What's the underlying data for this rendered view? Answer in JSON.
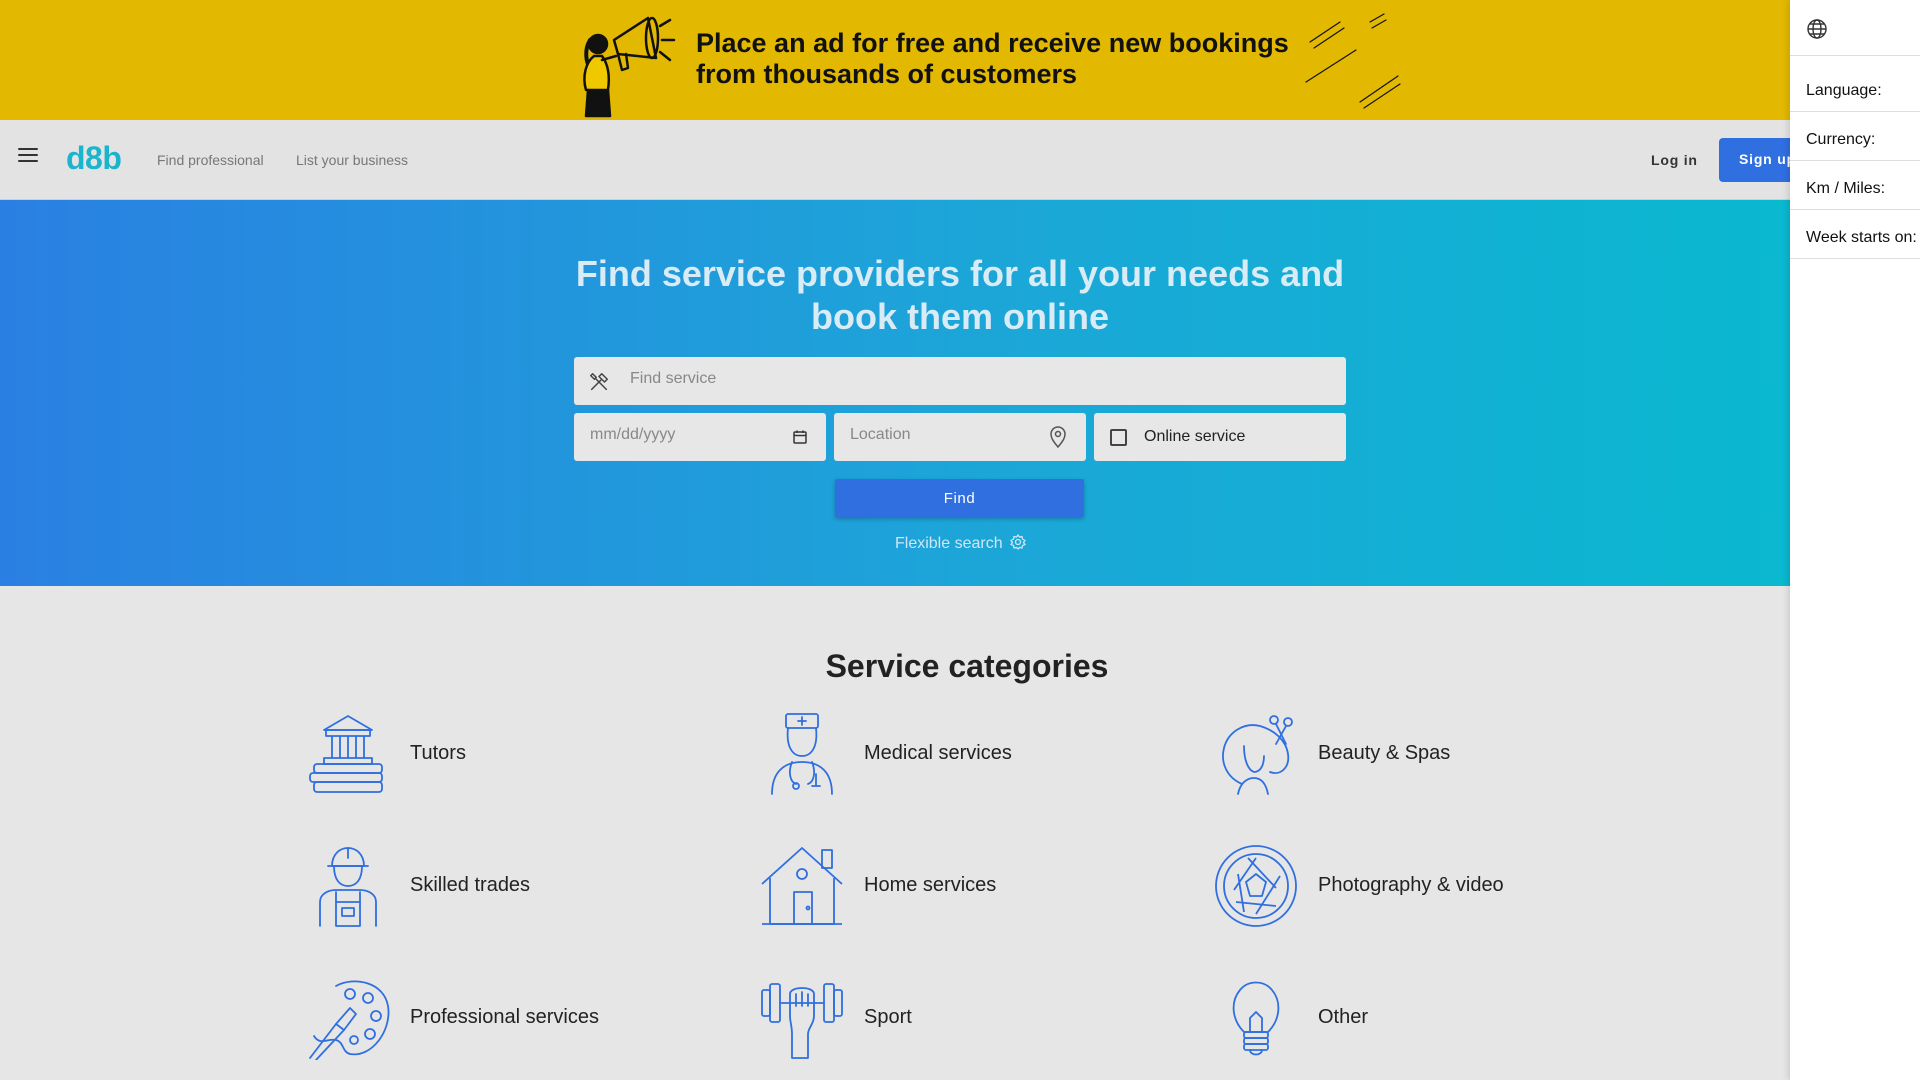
{
  "banner": {
    "text": "Place an ad for free and receive new bookings from thousands of customers"
  },
  "nav": {
    "logo": "d8b",
    "find_professional": "Find professional",
    "list_business": "List your business",
    "login": "Log in",
    "signup": "Sign up"
  },
  "hero": {
    "title": "Find service providers for all your needs and book them online",
    "service_placeholder": "Find service",
    "date_placeholder": "mm/dd/yyyy",
    "location_placeholder": "Location",
    "online_label": "Online service",
    "find_button": "Find",
    "flexible_search": "Flexible search"
  },
  "categories": {
    "title": "Service categories",
    "items": [
      {
        "label": "Tutors",
        "icon": "library-icon"
      },
      {
        "label": "Medical services",
        "icon": "nurse-icon"
      },
      {
        "label": "Beauty & Spas",
        "icon": "woman-scissors-icon"
      },
      {
        "label": "Skilled trades",
        "icon": "worker-icon"
      },
      {
        "label": "Home services",
        "icon": "house-icon"
      },
      {
        "label": "Photography & video",
        "icon": "aperture-icon"
      },
      {
        "label": "Professional services",
        "icon": "palette-icon"
      },
      {
        "label": "Sport",
        "icon": "dumbbell-icon"
      },
      {
        "label": "Other",
        "icon": "lightbulb-icon"
      }
    ]
  },
  "settings_panel": {
    "language": "Language:",
    "currency": "Currency:",
    "distance": "Km / Miles:",
    "week_start": "Week starts on:"
  },
  "colors": {
    "banner": "#e2b800",
    "primary_button": "#2f6fe0",
    "logo": "#1ab4cd",
    "icon_stroke": "#2f6fe0",
    "hero_gradient_start": "#2a80e2",
    "hero_gradient_end": "#0ab8d0"
  }
}
